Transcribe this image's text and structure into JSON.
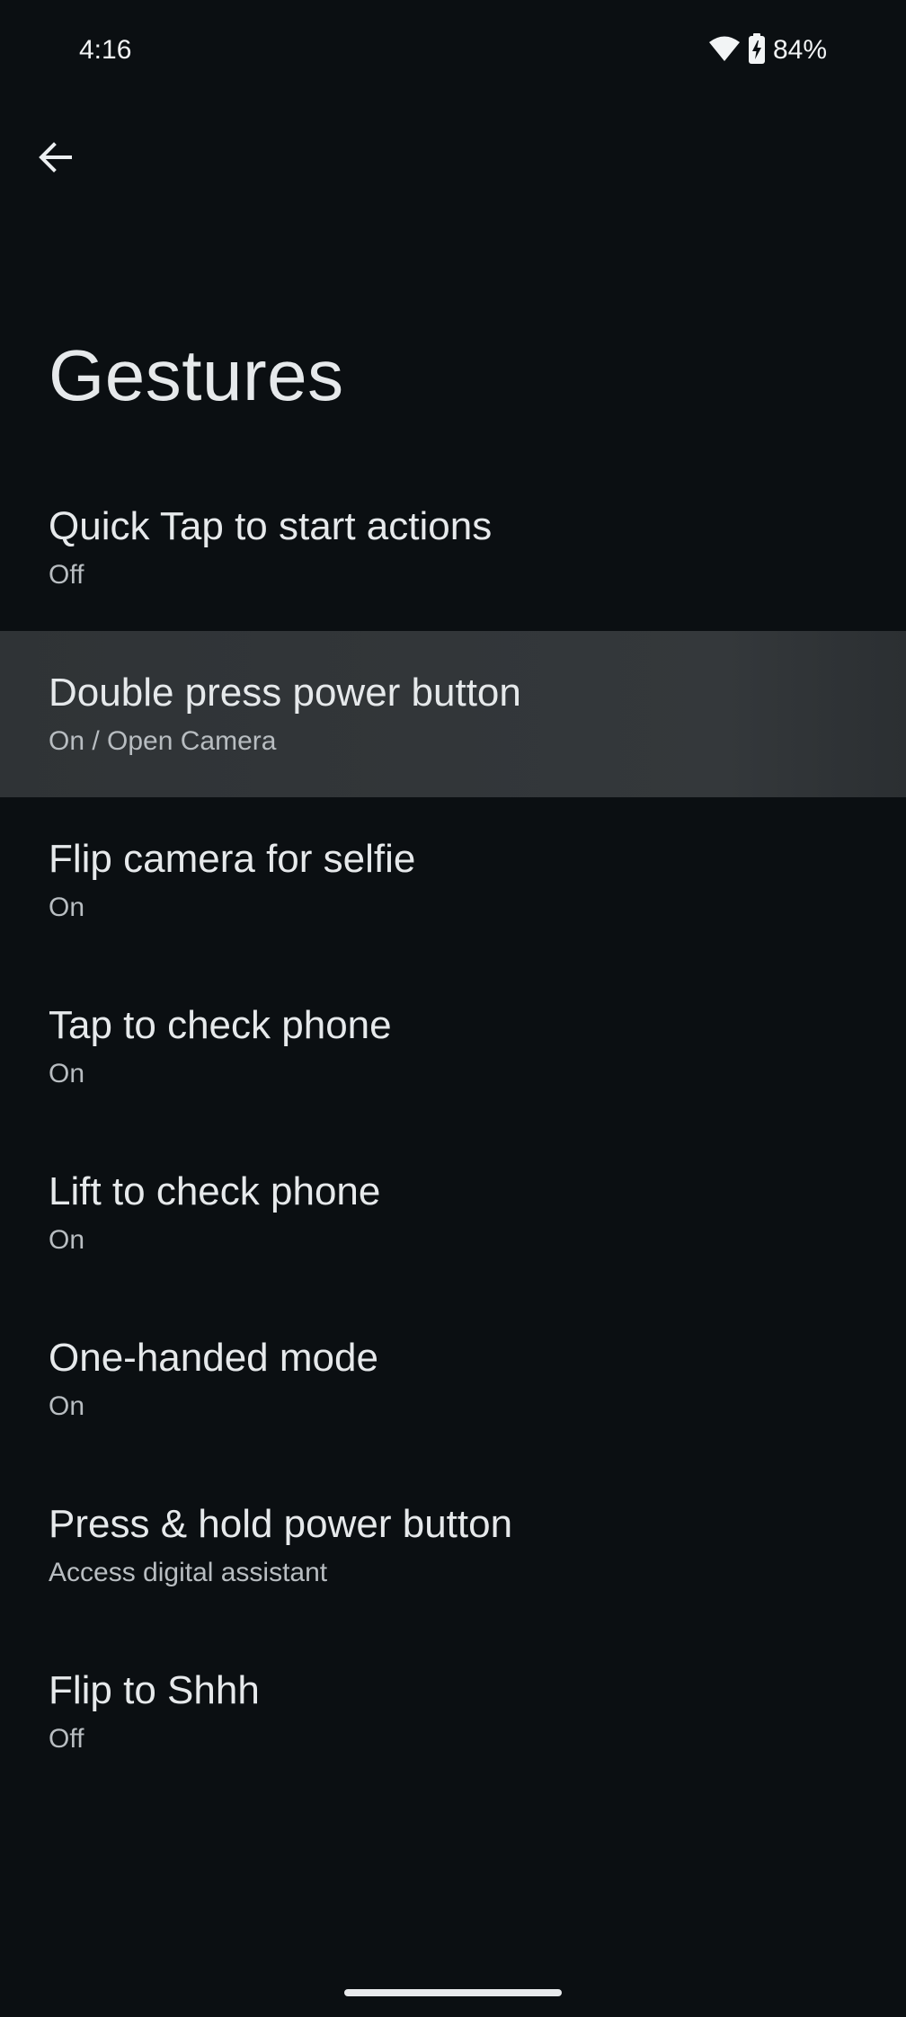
{
  "status_bar": {
    "time": "4:16",
    "battery_percent": "84%",
    "icons": [
      "wifi-icon",
      "battery-charging-icon"
    ]
  },
  "header": {
    "back_icon": "arrow-left-icon"
  },
  "page": {
    "title": "Gestures"
  },
  "settings": {
    "items": [
      {
        "title": "Quick Tap to start actions",
        "summary": "Off"
      },
      {
        "title": "Double press power button",
        "summary": "On / Open Camera",
        "highlighted": true
      },
      {
        "title": "Flip camera for selfie",
        "summary": "On"
      },
      {
        "title": "Tap to check phone",
        "summary": "On"
      },
      {
        "title": "Lift to check phone",
        "summary": "On"
      },
      {
        "title": "One-handed mode",
        "summary": "On"
      },
      {
        "title": "Press & hold power button",
        "summary": "Access digital assistant"
      },
      {
        "title": "Flip to Shhh",
        "summary": "Off"
      }
    ]
  },
  "colors": {
    "background": "#0b0f12",
    "highlight": "#33373a",
    "text_primary": "#e6e9eb",
    "text_secondary": "#b8bdc1"
  }
}
